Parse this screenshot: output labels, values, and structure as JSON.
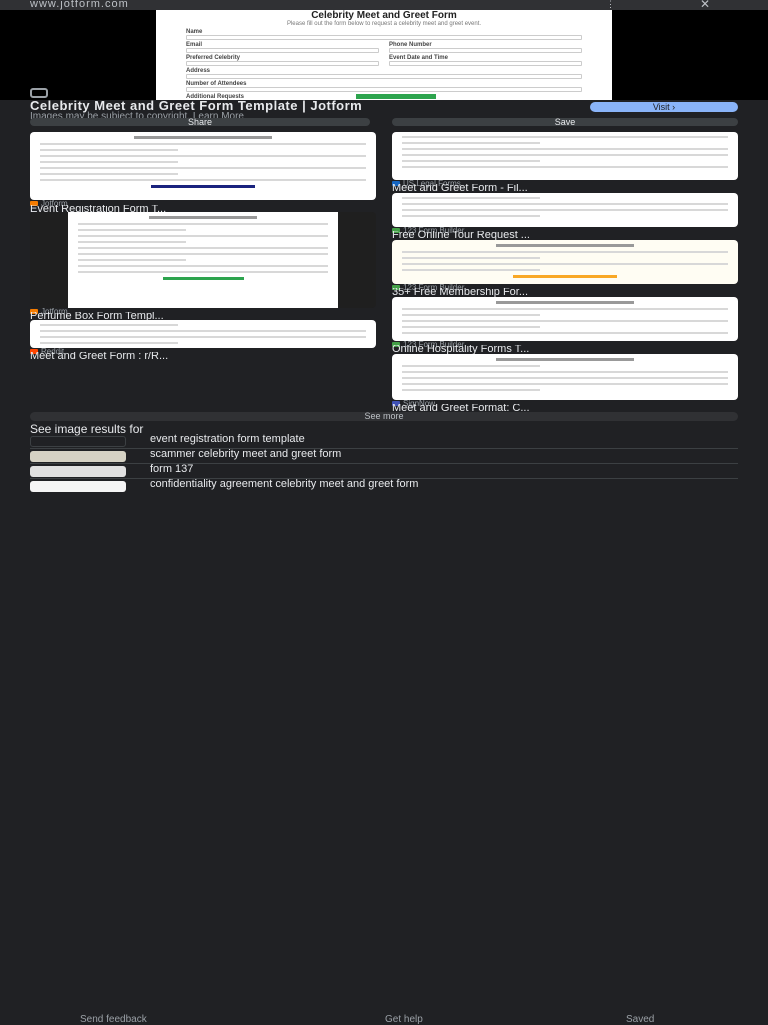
{
  "top": {
    "domain": "www.jotform.com",
    "more_glyph": "⋮",
    "close_glyph": "✕"
  },
  "preview": {
    "form_title": "Celebrity Meet and Greet Form",
    "form_subtitle": "Please fill out the form below to request a celebrity meet and greet event.",
    "fields": [
      {
        "left": "Name",
        "right": ""
      },
      {
        "left": "Email",
        "right": "Phone Number"
      },
      {
        "left": "Preferred Celebrity",
        "right": "Event Date and Time"
      },
      {
        "left": "Address",
        "right": ""
      },
      {
        "left": "Number of Attendees",
        "right": ""
      },
      {
        "left": "Additional Requests",
        "right": ""
      }
    ]
  },
  "result": {
    "title": "Celebrity Meet and Greet Form Template | Jotform",
    "note": "Images may be subject to copyright. Learn More",
    "visit_label": "Visit ›",
    "share_label": "Share",
    "save_label": "Save"
  },
  "grid": [
    {
      "source": "Jotform",
      "caption": "Event Registration Form T...",
      "icon": "#f57c00"
    },
    {
      "source": "Jotform",
      "caption": "Perfume Box Form Templ...",
      "icon": "#f57c00"
    },
    {
      "source": "Reddit",
      "caption": "Meet and Greet Form : r/R...",
      "icon": "#ff4500"
    },
    {
      "source": "US Legal Forms",
      "caption": "Meet and Greet Form - Fil...",
      "icon": "#1565c0"
    },
    {
      "source": "123 Form Builder",
      "caption": "Free Online Tour Request ...",
      "icon": "#43a047"
    },
    {
      "source": "123 Form Builder",
      "caption": "35+ Free Membership For...",
      "icon": "#43a047"
    },
    {
      "source": "123 Form Builder",
      "caption": "Online Hospitality Forms T...",
      "icon": "#43a047"
    },
    {
      "source": "SignNow",
      "caption": "Meet and Greet Format: C...",
      "icon": "#3f51b5"
    }
  ],
  "see_more_label": "See more",
  "related": {
    "heading": "See image results for",
    "items": [
      "event registration form template",
      "scammer celebrity meet and greet form",
      "form 137",
      "confidentiality agreement celebrity meet and greet form"
    ]
  },
  "footer": {
    "feedback": "Send feedback",
    "help": "Get help",
    "saved": "Saved"
  }
}
